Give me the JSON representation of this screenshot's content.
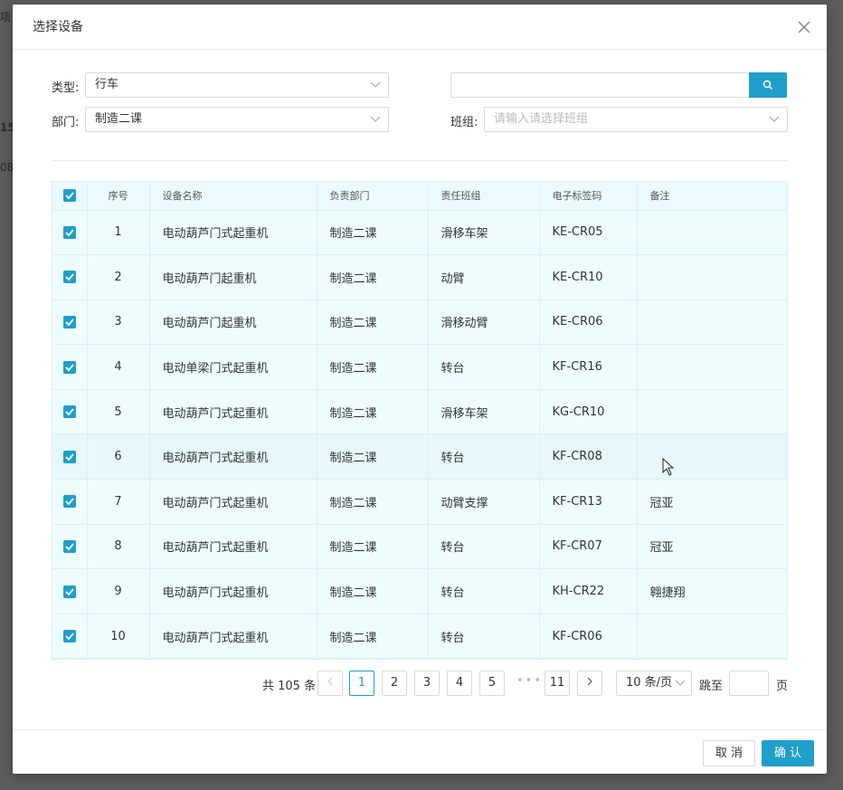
{
  "background": {
    "fragments": [
      "项",
      "15",
      "08"
    ]
  },
  "modal": {
    "title": "选择设备",
    "filters": {
      "type_label": "类型:",
      "type_value": "行车",
      "dept_label": "部门:",
      "dept_value": "制造二课",
      "team_label": "班组:",
      "team_placeholder": "请输入请选择班组",
      "search_value": ""
    },
    "table": {
      "headers": [
        "序号",
        "设备名称",
        "负责部门",
        "责任班组",
        "电子标签码",
        "备注"
      ],
      "rows": [
        [
          "1",
          "电动葫芦门式起重机",
          "制造二课",
          "滑移车架",
          "KE-CR05",
          ""
        ],
        [
          "2",
          "电动葫芦门起重机",
          "制造二课",
          "动臂",
          "KE-CR10",
          ""
        ],
        [
          "3",
          "电动葫芦门起重机",
          "制造二课",
          "滑移动臂",
          "KE-CR06",
          ""
        ],
        [
          "4",
          "电动单梁门式起重机",
          "制造二课",
          "转台",
          "KF-CR16",
          ""
        ],
        [
          "5",
          "电动葫芦门式起重机",
          "制造二课",
          "滑移车架",
          "KG-CR10",
          ""
        ],
        [
          "6",
          "电动葫芦门式起重机",
          "制造二课",
          "转台",
          "KF-CR08",
          ""
        ],
        [
          "7",
          "电动葫芦门式起重机",
          "制造二课",
          "动臂支撑",
          "KF-CR13",
          "冠亚"
        ],
        [
          "8",
          "电动葫芦门式起重机",
          "制造二课",
          "转台",
          "KF-CR07",
          "冠亚"
        ],
        [
          "9",
          "电动葫芦门式起重机",
          "制造二课",
          "转台",
          "KH-CR22",
          "翱捷翔"
        ],
        [
          "10",
          "电动葫芦门式起重机",
          "制造二课",
          "转台",
          "KF-CR06",
          ""
        ]
      ]
    },
    "pagination": {
      "total_text": "共 105 条",
      "pages": [
        "1",
        "2",
        "3",
        "4",
        "5"
      ],
      "last_page": "11",
      "current": "1",
      "page_size": "10 条/页",
      "jump_label": "跳至",
      "page_label": "页"
    },
    "footer": {
      "cancel": "取 消",
      "ok": "确 认"
    }
  },
  "colors": {
    "accent": "#1f9fcb",
    "row_bg": "#effcfe"
  }
}
